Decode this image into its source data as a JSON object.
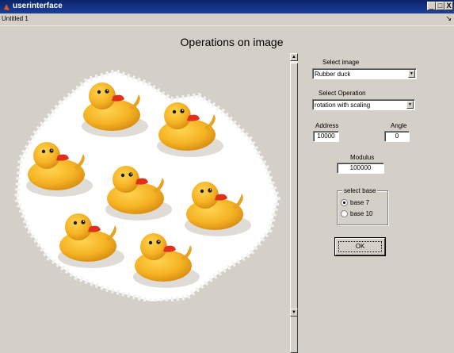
{
  "window": {
    "title": "userinterface",
    "minimize_label": "_",
    "maximize_label": "□",
    "close_label": "X"
  },
  "menubar": {
    "document_label": "Untitled 1",
    "pin_glyph": "↘"
  },
  "main": {
    "heading": "Operations on image"
  },
  "controls": {
    "select_image_label": "Select image",
    "select_image_value": "Rubber duck",
    "select_operation_label": "Select Operation",
    "select_operation_value": "rotation with scaling",
    "address_label": "Address",
    "address_value": "10000",
    "angle_label": "Angle",
    "angle_value": "0",
    "modulus_label": "Modulus",
    "modulus_value": "100000",
    "base_group_title": "select base",
    "base_options": [
      {
        "label": "base 7",
        "checked": true
      },
      {
        "label": "base 10",
        "checked": false
      }
    ],
    "ok_label": "OK"
  },
  "colors": {
    "titlebar": "#0a246a",
    "window_bg": "#d4d0c8",
    "duck_yellow": "#f5b324",
    "duck_beak": "#e0301c"
  }
}
